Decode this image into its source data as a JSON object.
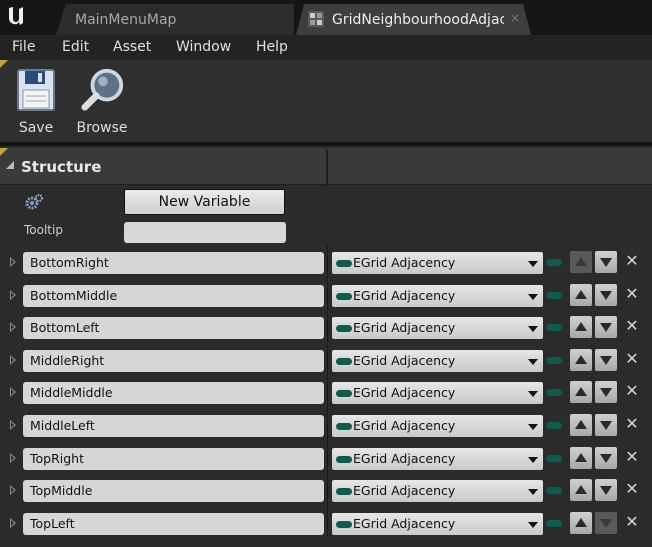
{
  "tabs": [
    {
      "label": "MainMenuMap",
      "active": false
    },
    {
      "label": "GridNeighbourhoodAdjac",
      "active": true,
      "close_glyph": "×"
    }
  ],
  "menu": [
    "File",
    "Edit",
    "Asset",
    "Window",
    "Help"
  ],
  "toolbar": {
    "save_label": "Save",
    "browse_label": "Browse"
  },
  "structure": {
    "title": "Structure",
    "new_variable_label": "New Variable",
    "tooltip_label": "Tooltip",
    "tooltip_value": ""
  },
  "variables": [
    {
      "name": "BottomRight",
      "type": "EGrid Adjacency",
      "up_enabled": false,
      "down_enabled": true
    },
    {
      "name": "BottomMiddle",
      "type": "EGrid Adjacency",
      "up_enabled": true,
      "down_enabled": true
    },
    {
      "name": "BottomLeft",
      "type": "EGrid Adjacency",
      "up_enabled": true,
      "down_enabled": true
    },
    {
      "name": "MiddleRight",
      "type": "EGrid Adjacency",
      "up_enabled": true,
      "down_enabled": true
    },
    {
      "name": "MiddleMiddle",
      "type": "EGrid Adjacency",
      "up_enabled": true,
      "down_enabled": true
    },
    {
      "name": "MiddleLeft",
      "type": "EGrid Adjacency",
      "up_enabled": true,
      "down_enabled": true
    },
    {
      "name": "TopRight",
      "type": "EGrid Adjacency",
      "up_enabled": true,
      "down_enabled": true
    },
    {
      "name": "TopMiddle",
      "type": "EGrid Adjacency",
      "up_enabled": true,
      "down_enabled": true
    },
    {
      "name": "TopLeft",
      "type": "EGrid Adjacency",
      "up_enabled": true,
      "down_enabled": false
    }
  ],
  "colors": {
    "accent": "#c7a13a",
    "pin": "#0d5c4c"
  },
  "icons": {
    "logo": "unreal-logo-icon",
    "save": "floppy-disk-icon",
    "browse": "magnifier-icon",
    "gear": "gear-icon",
    "delete": "close-icon"
  }
}
